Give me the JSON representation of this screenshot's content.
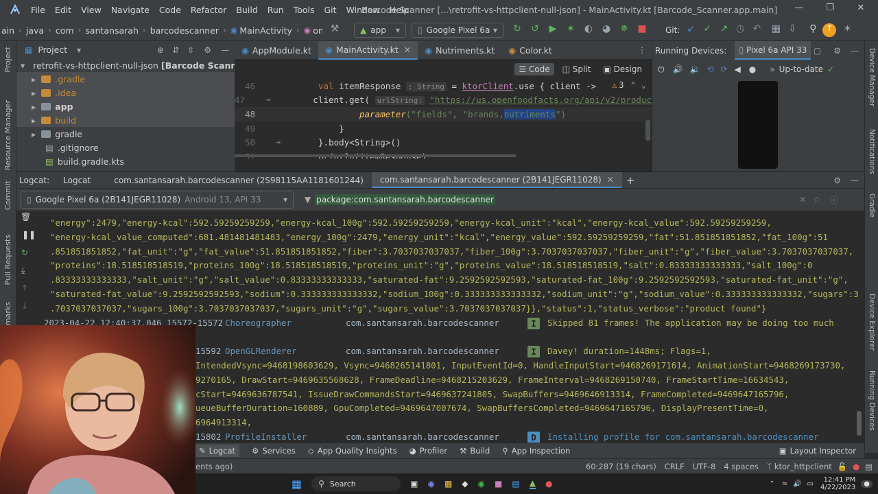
{
  "menu": [
    "File",
    "Edit",
    "View",
    "Navigate",
    "Code",
    "Refactor",
    "Build",
    "Run",
    "Tools",
    "Git",
    "Window",
    "Help"
  ],
  "window_title": "Barcode Scanner [...\\retrofit-vs-httpclient-null-json] - MainActivity.kt [Barcode_Scanner.app.main]",
  "breadcrumb": [
    "ain",
    "java",
    "com",
    "santansarah",
    "barcodescanner",
    "MainActivity",
    "onCreate"
  ],
  "run_config": "app",
  "device_combo": "Google Pixel 6a",
  "git_label": "Git:",
  "project_panel": {
    "title": "Project",
    "items": [
      {
        "label": "retrofit-vs-httpclient-null-json",
        "bold_suffix": "[Barcode Scanner]"
      },
      {
        "label": ".gradle"
      },
      {
        "label": ".idea"
      },
      {
        "label": "app"
      },
      {
        "label": "build"
      },
      {
        "label": "gradle"
      },
      {
        "label": ".gitignore"
      },
      {
        "label": "build.gradle.kts"
      }
    ]
  },
  "editor": {
    "tabs": [
      "AppModule.kt",
      "MainActivity.kt",
      "Nutriments.kt",
      "Color.kt"
    ],
    "modes": [
      "Code",
      "Split",
      "Design"
    ],
    "warning_count": "3",
    "line_numbers": [
      "46",
      "47",
      "48",
      "49",
      "50",
      "51"
    ],
    "lines": {
      "l46": {
        "kw": "val ",
        "name": "itemResponse",
        "hint": ": String",
        "eq": " = ",
        "fn": "ktorClient",
        "rest": ".use { client ->"
      },
      "l47": {
        "call": "client.get(",
        "hint": "urlString:",
        "url": "\"https://us.openfoodfacts.org/api/v2/produc"
      },
      "l48": {
        "fn": "parameter",
        "args_a": "(\"fields\", \"brands,",
        "args_b": "nutriments",
        "args_c": "\")"
      },
      "l49": "}",
      "l50": "}.body<String>()",
      "l51": {
        "fn": "println",
        "rest": "(itemResponse)"
      }
    }
  },
  "devices": {
    "title": "Running Devices:",
    "tab": "Pixel 6a API 33",
    "status": "Up-to-date"
  },
  "logcat": {
    "label": "Logcat:",
    "tabs": [
      "Logcat",
      "com.santansarah.barcodescanner (2S98115AA1181601244)",
      "com.santansarah.barcodescanner (2B141JEGR11028)"
    ],
    "device_select": "Google Pixel 6a (2B141JEGR11028)",
    "device_detail": "Android 13, API 33",
    "filter": "package:com.santansarah.barcodescanner",
    "lines": [
      "\"energy\":2479,\"energy-kcal\":592.59259259259,\"energy-kcal_100g\":592.59259259259,\"energy-kcal_unit\":\"kcal\",\"energy-kcal_value\":592.59259259259,",
      "\"energy-kcal_value_computed\":681.481481481483,\"energy_100g\":2479,\"energy_unit\":\"kcal\",\"energy_value\":592.59259259259,\"fat\":51.851851851852,\"fat_100g\":51",
      ".851851851852,\"fat_unit\":\"g\",\"fat_value\":51.851851851852,\"fiber\":3.7037037037037,\"fiber_100g\":3.7037037037037,\"fiber_unit\":\"g\",\"fiber_value\":3.7037037037037,",
      "\"proteins\":18.518518518519,\"proteins_100g\":18.518518518519,\"proteins_unit\":\"g\",\"proteins_value\":18.518518518519,\"salt\":0.83333333333333,\"salt_100g\":0",
      ".83333333333333,\"salt_unit\":\"g\",\"salt_value\":0.83333333333333,\"saturated-fat\":9.2592592592593,\"saturated-fat_100g\":9.2592592592593,\"saturated-fat_unit\":\"g\",",
      "\"saturated-fat_value\":9.2592592592593,\"sodium\":0.333333333333332,\"sodium_100g\":0.333333333333332,\"sodium_unit\":\"g\",\"sodium_value\":0.333333333333332,\"sugars\":3",
      ".7037037037037,\"sugars_100g\":3.7037037037037,\"sugars_unit\":\"g\",\"sugars_value\":3.7037037037037}},\"status\":1,\"status_verbose\":\"product found\"}"
    ],
    "entry1": {
      "ts": "2023-04-22 12:40:37.046 15572-15572",
      "tag": "Choreographer",
      "pkg": "com.santansarah.barcodescanner",
      "level": "I",
      "msg": "Skipped 81 frames!  The application may be doing too much"
    },
    "entry2": {
      "ts": "15592",
      "tag": "OpenGLRenderer",
      "pkg": "com.santansarah.barcodescanner",
      "level": "I",
      "msg": "Davey! duration=1448ms; Flags=1,"
    },
    "entry2_cont": [
      "IntendedVsync=9468198603629, Vsync=9468265141801, InputEventId=0, HandleInputStart=9468269171614, AnimationStart=9468269173730,",
      "9270165, DrawStart=9469635568628, FrameDeadline=9468215203629, FrameInterval=9468269150740, FrameStartTime=16634543,",
      "cStart=9469636787541, IssueDrawCommandsStart=9469637241805, SwapBuffers=9469646913314, FrameCompleted=9469647165796,",
      "ueueBufferDuration=160889, GpuCompleted=9469647007674, SwapBuffersCompleted=9469647165796, DisplayPresentTime=0,",
      "6964913314,"
    ],
    "entry3": {
      "ts": "15802",
      "tag": "ProfileInstaller",
      "pkg": "com.santansarah.barcodescanner",
      "level": "D",
      "msg": "Installing profile for com.santansarah.barcodescanner"
    }
  },
  "tool_windows": [
    "Logcat",
    "Services",
    "App Quality Insights",
    "Profiler",
    "Build",
    "App Inspection"
  ],
  "layout_inspector": "Layout Inspector",
  "status_bar": {
    "left": "ents ago)",
    "position": "60:287 (19 chars)",
    "line_sep": "CRLF",
    "encoding": "UTF-8",
    "indent": "4 spaces",
    "branch": "ktor_httpclient"
  },
  "side_labels": {
    "left": [
      "Project",
      "Resource Manager",
      "Commit",
      "Pull Requests",
      "kmarks"
    ],
    "right": [
      "Device Manager",
      "Notifications",
      "Gradle",
      "Device Explorer",
      "Running Devices"
    ]
  },
  "taskbar": {
    "search": "Search",
    "time": "12:41 PM",
    "date": "4/22/2023"
  },
  "colors": {
    "accent": "#4a88c7",
    "log_text": "#b7b75c",
    "level_info": "#6a8759",
    "level_debug": "#4b8fbf"
  }
}
